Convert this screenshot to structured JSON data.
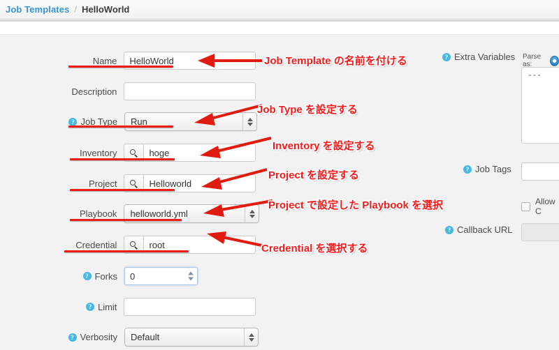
{
  "breadcrumb": {
    "parent": "Job Templates",
    "separator": "/",
    "current": "HelloWorld"
  },
  "form": {
    "fields": [
      {
        "label": "Name",
        "value": "HelloWorld",
        "type": "text",
        "help": false
      },
      {
        "label": "Description",
        "value": "",
        "type": "text",
        "help": false
      },
      {
        "label": "Job Type",
        "value": "Run",
        "type": "select",
        "help": true
      },
      {
        "label": "Inventory",
        "value": "hoge",
        "type": "lookup",
        "help": false
      },
      {
        "label": "Project",
        "value": "Helloworld",
        "type": "lookup",
        "help": false
      },
      {
        "label": "Playbook",
        "value": "helloworld.yml",
        "type": "select",
        "help": false
      },
      {
        "label": "Credential",
        "value": "root",
        "type": "lookup",
        "help": false
      },
      {
        "label": "Forks",
        "value": "0",
        "type": "number",
        "help": true
      },
      {
        "label": "Limit",
        "value": "",
        "type": "text",
        "help": true
      },
      {
        "label": "Verbosity",
        "value": "Default",
        "type": "select",
        "help": true
      }
    ]
  },
  "right_panel": {
    "extra_variables_label": "Extra Variables",
    "parse_as_label": "Parse as:",
    "extra_variables_value": "---",
    "job_tags_label": "Job Tags",
    "job_tags_value": "",
    "allow_callback_label": "Allow C",
    "callback_url_label": "Callback URL",
    "callback_url_value": ""
  },
  "annotations": [
    {
      "text": "Job Template の名前を付ける"
    },
    {
      "text": "Job Type を設定する"
    },
    {
      "text": "Inventory を設定する"
    },
    {
      "text": "Project を設定する"
    },
    {
      "text": "Project で設定した Playbook を選択"
    },
    {
      "text": "Credential を選択する"
    }
  ],
  "colors": {
    "annotation_red": "#f51b1b",
    "underline_red": "#ed1c16",
    "link_blue": "#3596d4",
    "help_blue": "#46b8e4",
    "panel_bg": "#f2f2f2"
  }
}
